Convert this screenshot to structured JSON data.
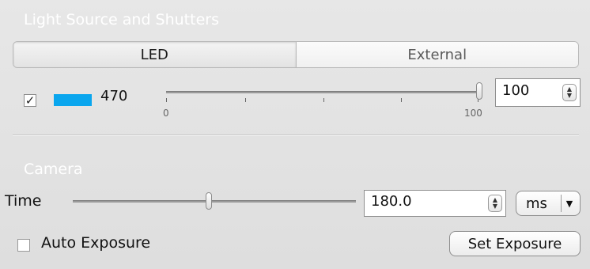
{
  "light_section": {
    "title": "Light Source and Shutters",
    "tabs": [
      {
        "label": "LED",
        "active": true
      },
      {
        "label": "External",
        "active": false
      }
    ],
    "channel": {
      "checked": true,
      "check_glyph": "✓",
      "color": "#0aa6ee",
      "wavelength": "470",
      "slider_value": 100,
      "slider_min_label": "0",
      "slider_max_label": "100",
      "spin_value": "100"
    }
  },
  "camera_section": {
    "title": "Camera",
    "time_label": "Time",
    "time_slider_fraction": 0.48,
    "time_value": "180.0",
    "unit": "ms",
    "auto_exposure_label": "Auto Exposure",
    "auto_exposure_checked": false,
    "set_exposure_label": "Set Exposure"
  },
  "icons": {
    "spin_up": "▲",
    "spin_down": "▼",
    "dropdown": "▼"
  }
}
